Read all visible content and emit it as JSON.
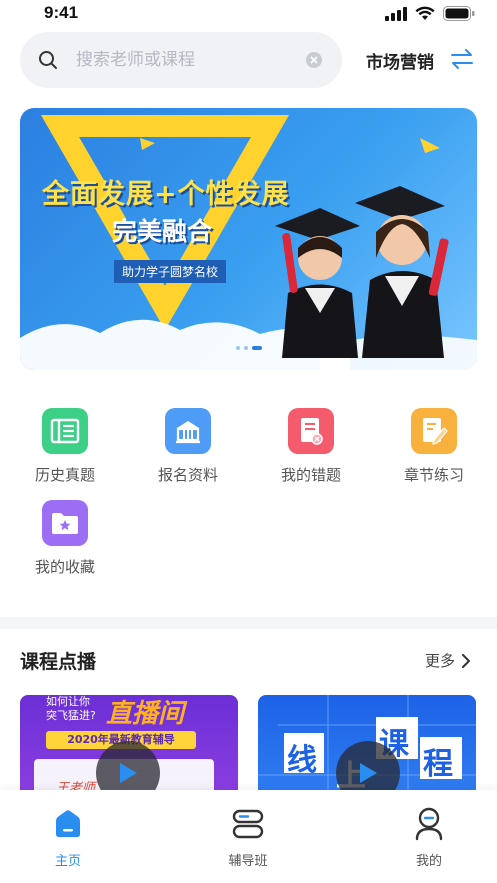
{
  "status": {
    "time": "9:41"
  },
  "search": {
    "placeholder": "搜索老师或课程"
  },
  "subject": {
    "label": "市场营销"
  },
  "banner": {
    "title": "全面发展+个性发展",
    "subtitle": "完美融合",
    "tag": "助力学子圆梦名校",
    "slide_count": 3,
    "active_slide": 3
  },
  "grid": {
    "items": [
      {
        "label": "历史真题",
        "icon": "history-exam-icon",
        "color": "#3ccf86"
      },
      {
        "label": "报名资料",
        "icon": "registration-icon",
        "color": "#4f9cf6"
      },
      {
        "label": "我的错题",
        "icon": "wrong-question-icon",
        "color": "#f45b6c"
      },
      {
        "label": "章节练习",
        "icon": "chapter-practice-icon",
        "color": "#f8b13c"
      },
      {
        "label": "我的收藏",
        "icon": "favorites-icon",
        "color": "#9b6ef3"
      }
    ]
  },
  "courses": {
    "title": "课程点播",
    "more": "更多",
    "items": [
      {
        "line1": "如何让你",
        "line2": "突飞猛进?",
        "headline": "直播间",
        "banner": "2020年最新教育辅导",
        "teacher": "王老师"
      },
      {
        "headline_chars": [
          "线",
          "上",
          "课",
          "程"
        ]
      }
    ]
  },
  "tabbar": {
    "items": [
      {
        "label": "主页",
        "icon": "home-icon",
        "active": true
      },
      {
        "label": "辅导班",
        "icon": "class-icon",
        "active": false
      },
      {
        "label": "我的",
        "icon": "profile-icon",
        "active": false
      }
    ]
  },
  "colors": {
    "accent": "#2a8ef0",
    "banner_blue": "#2b7fe0"
  }
}
